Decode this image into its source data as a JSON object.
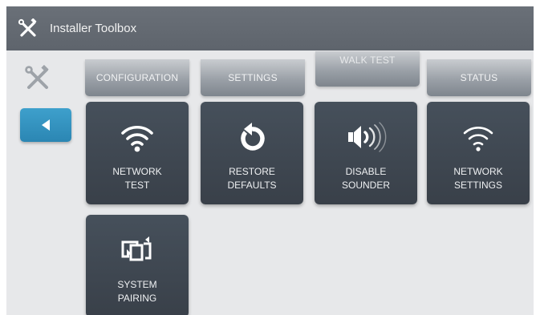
{
  "header": {
    "title": "Installer Toolbox",
    "app_icon": "tools-icon"
  },
  "sidebar": {
    "tools_icon": "tools-icon",
    "back_icon": "back-arrow-icon"
  },
  "tabs": [
    {
      "label": "CONFIGURATION"
    },
    {
      "label": "SETTINGS"
    },
    {
      "label": "WALK TEST"
    },
    {
      "label": "STATUS"
    }
  ],
  "tiles": [
    {
      "line1": "NETWORK",
      "line2": "TEST",
      "icon": "wifi-icon"
    },
    {
      "line1": "RESTORE",
      "line2": "DEFAULTS",
      "icon": "restore-icon"
    },
    {
      "line1": "DISABLE",
      "line2": "SOUNDER",
      "icon": "speaker-icon"
    },
    {
      "line1": "NETWORK",
      "line2": "SETTINGS",
      "icon": "wifi-icon"
    },
    {
      "line1": "SYSTEM",
      "line2": "PAIRING",
      "icon": "pairing-icon"
    }
  ],
  "colors": {
    "header_bg": "#62686f",
    "tile_bg": "#3f4750",
    "back_button": "#3498c4",
    "background": "#e7e8ea"
  }
}
